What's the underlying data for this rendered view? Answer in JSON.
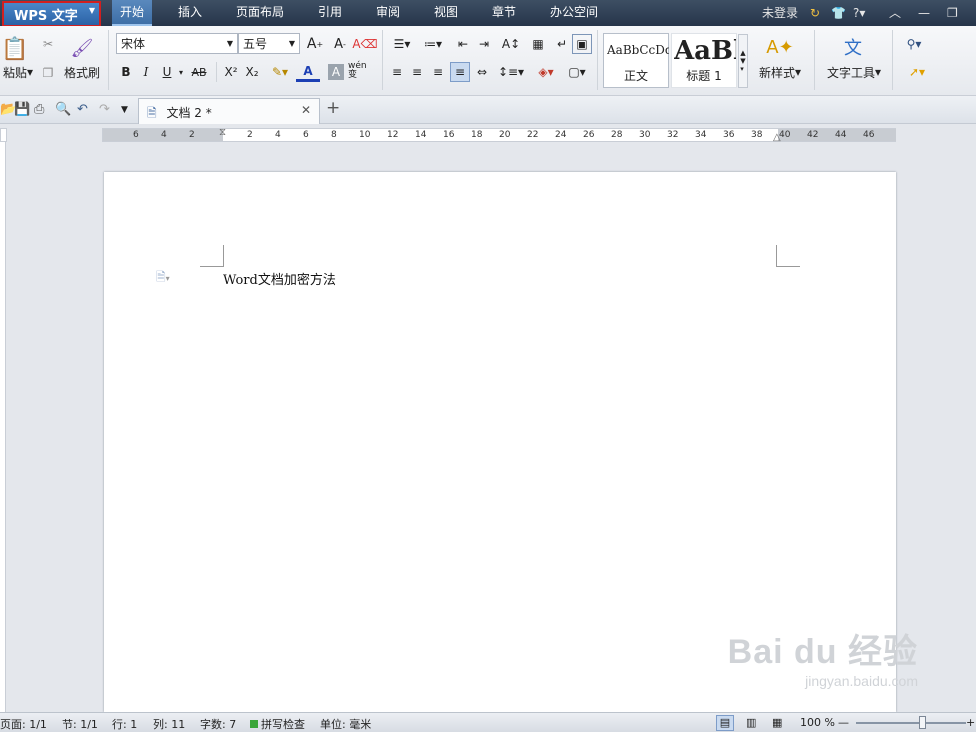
{
  "menubar": {
    "app_button": "WPS 文字",
    "tabs": [
      "开始",
      "插入",
      "页面布局",
      "引用",
      "审阅",
      "视图",
      "章节",
      "办公空间"
    ],
    "login": "未登录",
    "help": "?"
  },
  "ribbon": {
    "paste": "粘贴",
    "format_painter": "格式刷",
    "font_name": "宋体",
    "font_size": "五号",
    "bold": "B",
    "italic": "I",
    "underline": "U",
    "strike": "AB",
    "superscript": "X²",
    "subscript": "X₂",
    "font_color": "A",
    "char_shading": "A",
    "phonetic": "wén 变",
    "style_normal_preview": "AaBbCcDd",
    "style_normal": "正文",
    "style_heading_preview": "AaBl",
    "style_heading": "标题 1",
    "new_style": "新样式",
    "text_tools": "文字工具"
  },
  "quickbar": {
    "doc_tab": "文档 2 *",
    "new_tab": "+"
  },
  "ruler": {
    "left_ticks": [
      "6",
      "4",
      "2"
    ],
    "ticks": [
      "2",
      "4",
      "6",
      "8",
      "10",
      "12",
      "14",
      "16",
      "18",
      "20",
      "22",
      "24",
      "26",
      "28",
      "30",
      "32",
      "34",
      "36",
      "38",
      "40",
      "42",
      "44",
      "46"
    ]
  },
  "document": {
    "text": "Word文档加密方法"
  },
  "status": {
    "page": "页面: 1/1",
    "section": "节: 1/1",
    "row": "行: 1",
    "col": "列: 11",
    "words": "字数: 7",
    "spell": "拼写检查",
    "unit": "单位: 毫米",
    "zoom": "100 %",
    "zoom_minus": "—",
    "zoom_plus": "+"
  },
  "watermark": {
    "brand": "Bai du 经验",
    "url": "jingyan.baidu.com"
  }
}
